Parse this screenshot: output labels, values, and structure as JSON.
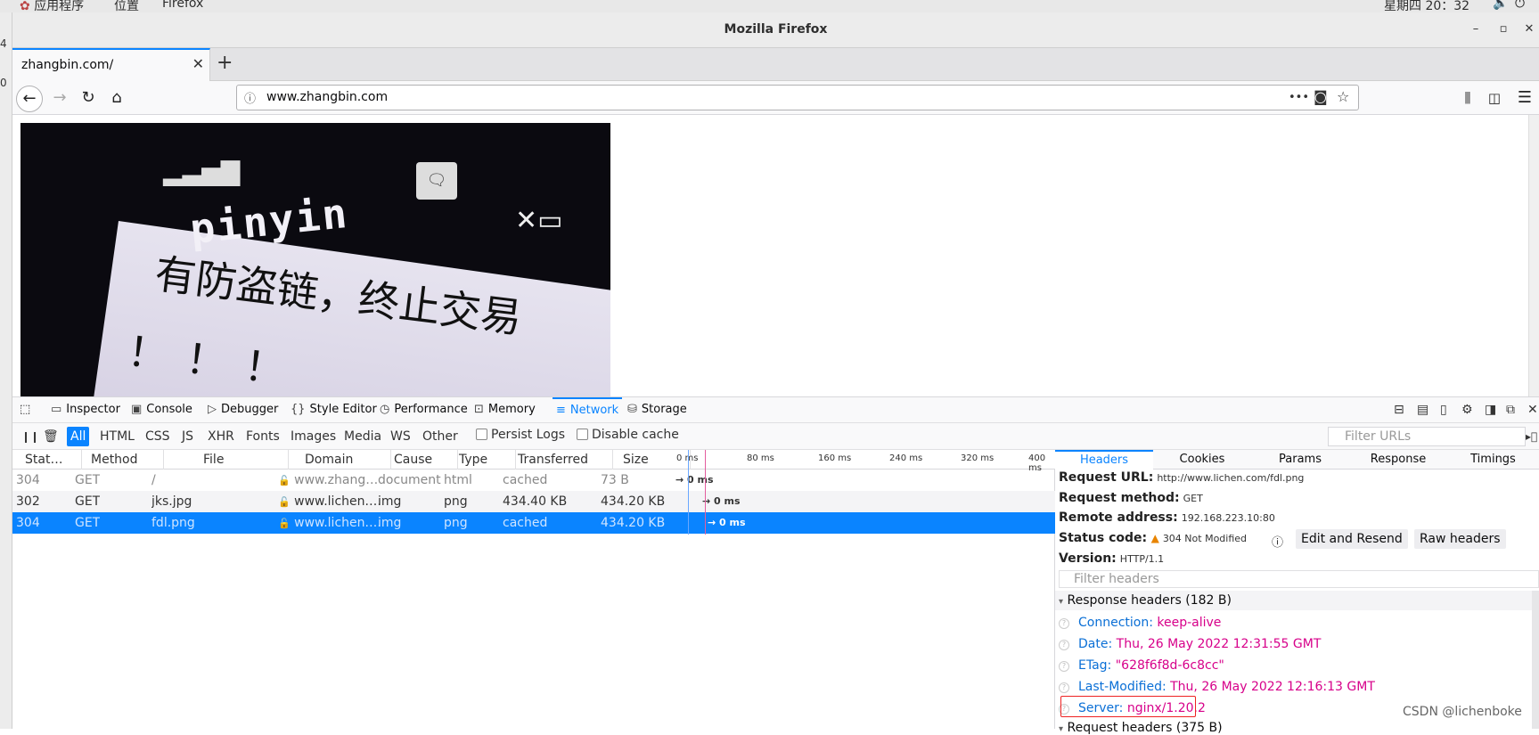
{
  "topbar": {
    "apps": "应用程序",
    "places": "位置",
    "firefox": "Firefox",
    "clock": "星期四 20：32"
  },
  "left_edge": {
    "a": "4",
    "b": "0"
  },
  "window": {
    "title": "Mozilla Firefox",
    "minimize": "–",
    "maximize": "▫",
    "close": "✕"
  },
  "tab": {
    "label": "zhangbin.com/",
    "close": "✕",
    "new_tab": "+"
  },
  "nav": {
    "url": "www.zhangbin.com",
    "more": "•••"
  },
  "page_image": {
    "brand_text": "pinyin",
    "message_line1": "有防盗链，终止交易",
    "message_line2": "！！！"
  },
  "devtools": {
    "tabs": [
      "Inspector",
      "Console",
      "Debugger",
      "Style Editor",
      "Performance",
      "Memory",
      "Network",
      "Storage"
    ],
    "active_tab": "Network",
    "filters": [
      "All",
      "HTML",
      "CSS",
      "JS",
      "XHR",
      "Fonts",
      "Images",
      "Media",
      "WS",
      "Other"
    ],
    "persist_logs": "Persist Logs",
    "disable_cache": "Disable cache",
    "filter_urls_placeholder": "Filter URLs",
    "columns": [
      "Stat…",
      "Method",
      "File",
      "Domain",
      "Cause",
      "Type",
      "Transferred",
      "Size"
    ],
    "timeline_ticks": [
      "0 ms",
      "80 ms",
      "160 ms",
      "240 ms",
      "320 ms",
      "400 ms"
    ],
    "rows": [
      {
        "status": "304",
        "method": "GET",
        "file": "/",
        "domain": "www.zhang…",
        "cause": "document",
        "type": "html",
        "transferred": "cached",
        "size": "73 B",
        "timing": "0 ms"
      },
      {
        "status": "302",
        "method": "GET",
        "file": "jks.jpg",
        "domain": "www.lichen.…",
        "cause": "img",
        "type": "png",
        "transferred": "434.40 KB",
        "size": "434.20 KB",
        "timing": "0 ms"
      },
      {
        "status": "304",
        "method": "GET",
        "file": "fdl.png",
        "domain": "www.lichen.…",
        "cause": "img",
        "type": "png",
        "transferred": "cached",
        "size": "434.20 KB",
        "timing": "0 ms"
      }
    ],
    "selected_row": 2
  },
  "panel": {
    "tabs": [
      "Headers",
      "Cookies",
      "Params",
      "Response",
      "Timings"
    ],
    "active_tab": "Headers",
    "request_url_label": "Request URL:",
    "request_url": "http://www.lichen.com/fdl.png",
    "request_method_label": "Request method:",
    "request_method": "GET",
    "remote_address_label": "Remote address:",
    "remote_address": "192.168.223.10:80",
    "status_code_label": "Status code:",
    "status_code": "304 Not Modified",
    "version_label": "Version:",
    "version": "HTTP/1.1",
    "edit_resend": "Edit and Resend",
    "raw_headers": "Raw headers",
    "filter_headers_placeholder": "Filter headers",
    "response_headers_title": "Response headers (182 B)",
    "headers": [
      {
        "name": "Connection:",
        "value": "keep-alive"
      },
      {
        "name": "Date:",
        "value": "Thu, 26 May 2022 12:31:55 GMT"
      },
      {
        "name": "ETag:",
        "value": "\"628f6f8d-6c8cc\""
      },
      {
        "name": "Last-Modified:",
        "value": "Thu, 26 May 2022 12:16:13 GMT"
      },
      {
        "name": "Server:",
        "value": "nginx/1.20.2"
      }
    ],
    "request_headers_title": "Request headers (375 B)"
  },
  "watermark": "CSDN @lichenboke",
  "colors": {
    "accent": "#0a84ff",
    "header_key": "#0a6fd6",
    "header_value": "#d7008a",
    "highlight_box": "#e22222"
  }
}
